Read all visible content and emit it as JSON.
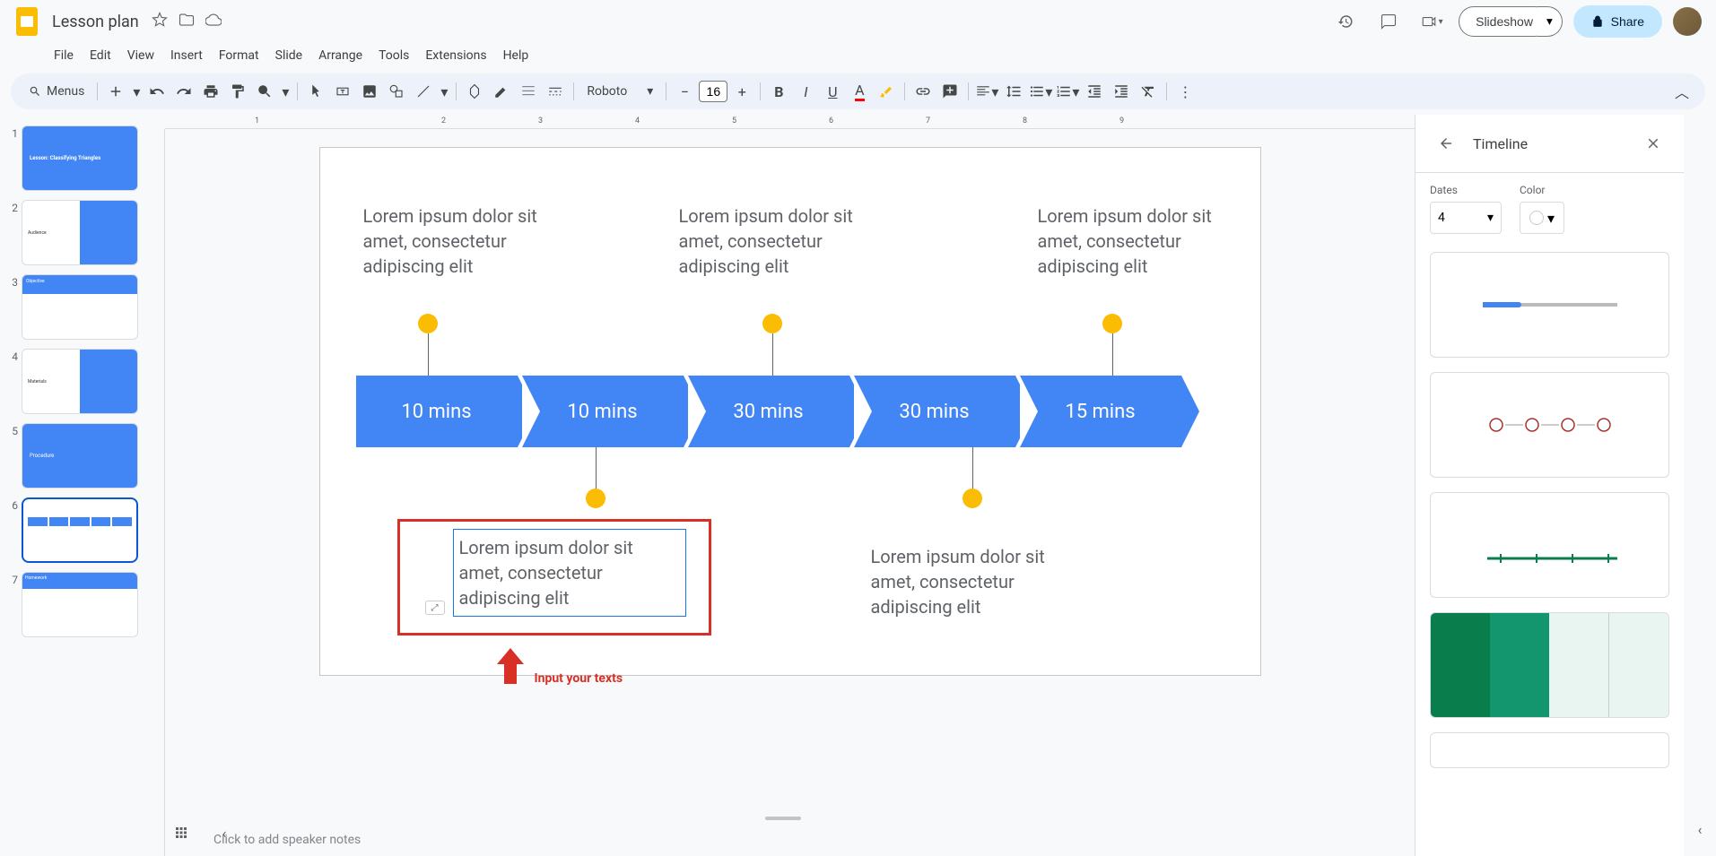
{
  "doc": {
    "title": "Lesson plan"
  },
  "menus": [
    "File",
    "Edit",
    "View",
    "Insert",
    "Format",
    "Slide",
    "Arrange",
    "Tools",
    "Extensions",
    "Help"
  ],
  "toolbar": {
    "menus_label": "Menus",
    "font": "Roboto",
    "font_size": "16"
  },
  "header": {
    "slideshow": "Slideshow",
    "share": "Share"
  },
  "slides": [
    {
      "num": "1"
    },
    {
      "num": "2"
    },
    {
      "num": "3"
    },
    {
      "num": "4"
    },
    {
      "num": "5"
    },
    {
      "num": "6"
    },
    {
      "num": "7"
    }
  ],
  "thumbs": {
    "t1_title": "Lesson: Classifying Triangles",
    "t2_title": "Audience",
    "t3_title": "Objective",
    "t4_title": "Materials",
    "t5_title": "Procedure",
    "t7_title": "Homework"
  },
  "canvas": {
    "lorem": "Lorem ipsum dolor sit amet, consectetur adipiscing elit",
    "times": [
      "10 mins",
      "10 mins",
      "30 mins",
      "30 mins",
      "15 mins"
    ]
  },
  "annotation": {
    "text": "Input your texts"
  },
  "notes": {
    "placeholder": "Click to add speaker notes"
  },
  "sidepanel": {
    "title": "Timeline",
    "dates_label": "Dates",
    "dates_value": "4",
    "color_label": "Color"
  },
  "ruler": {
    "ticks": [
      "1",
      "2",
      "3",
      "4",
      "5",
      "6",
      "7",
      "8",
      "9"
    ]
  }
}
